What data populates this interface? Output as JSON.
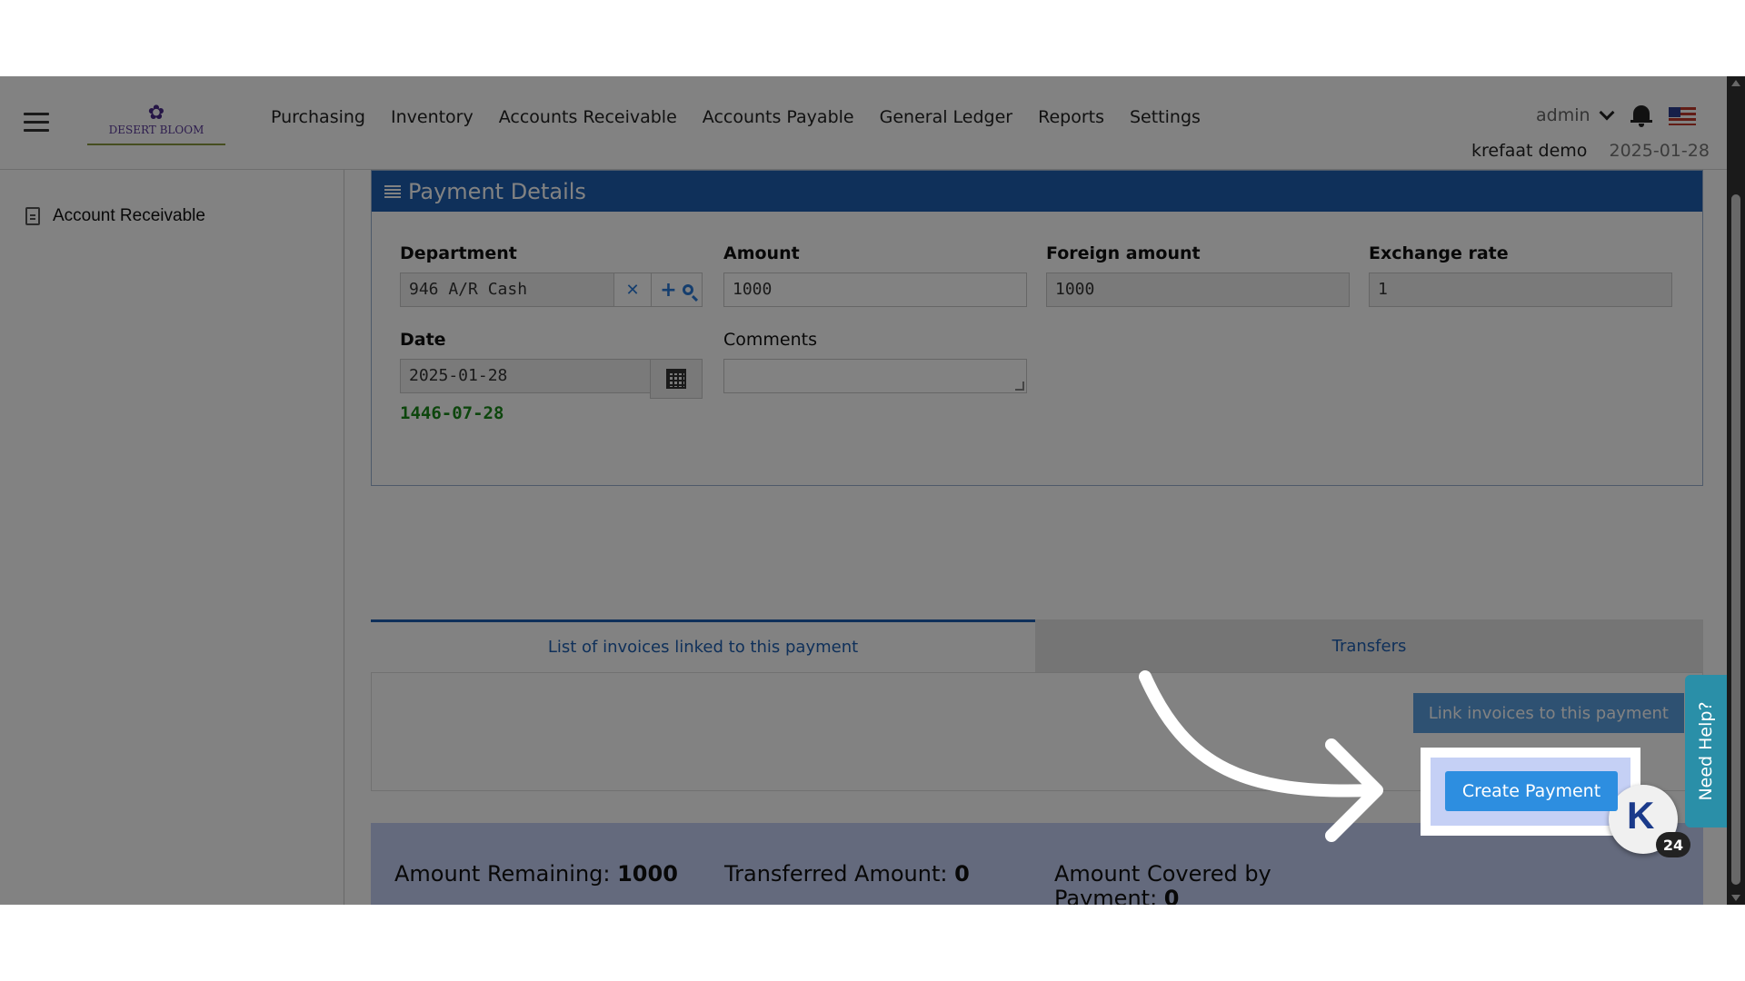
{
  "header": {
    "logo_text": "DESERT BLOOM",
    "nav": [
      "Purchasing",
      "Inventory",
      "Accounts Receivable",
      "Accounts Payable",
      "General Ledger",
      "Reports",
      "Settings"
    ],
    "user_menu": "admin",
    "user_name": "krefaat demo",
    "current_date": "2025-01-28"
  },
  "sidebar": {
    "items": [
      {
        "label": "Account Receivable",
        "icon": "receivable-icon"
      }
    ]
  },
  "payment_details": {
    "title": "Payment Details",
    "department": {
      "label": "Department",
      "value": "946 A/R Cash"
    },
    "amount": {
      "label": "Amount",
      "value": "1000"
    },
    "foreign_amount": {
      "label": "Foreign amount",
      "value": "1000"
    },
    "exchange_rate": {
      "label": "Exchange rate",
      "value": "1"
    },
    "date": {
      "label": "Date",
      "value": "2025-01-28",
      "hijri": "1446-07-28"
    },
    "comments": {
      "label": "Comments",
      "value": ""
    }
  },
  "tabs": [
    {
      "label": "List of invoices linked to this payment",
      "active": true
    },
    {
      "label": "Transfers",
      "active": false
    }
  ],
  "link_button": "Link invoices to this payment",
  "summary": {
    "remaining_label": "Amount Remaining:",
    "remaining_value": "1000",
    "transferred_label": "Transferred Amount:",
    "transferred_value": "0",
    "covered_label_line1": "Amount Covered by",
    "covered_label_line2": "Payment:",
    "covered_value": "0"
  },
  "create_button": "Create Payment",
  "help_tab": "Need Help?",
  "chat": {
    "badge": "24"
  },
  "colors": {
    "header_blue": "#1f5fb0",
    "button_blue": "#2d8ee0",
    "hijri_green": "#1a8a1a",
    "summary_bg": "#c5d0f5"
  }
}
